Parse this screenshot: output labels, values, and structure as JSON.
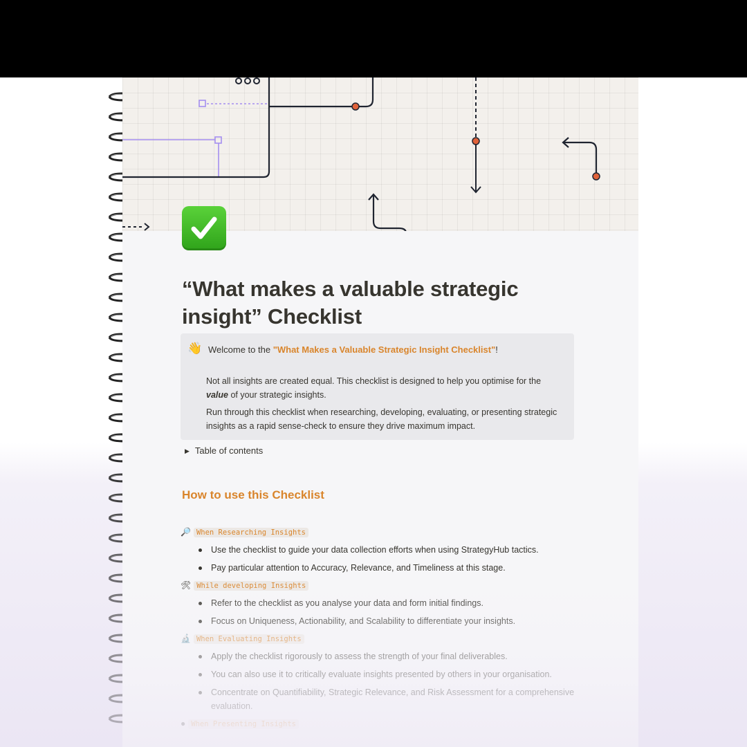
{
  "page": {
    "title": "“What makes a valuable strategic insight” Checklist",
    "icon": "check-mark-button-icon"
  },
  "callout": {
    "emoji": "👋",
    "lead_prefix": "Welcome to the ",
    "lead_highlight": "\"What Makes a Valuable Strategic Insight Checklist\"",
    "lead_suffix": "!",
    "p1_before": "Not all insights are created equal. This checklist is designed to help you optimise for the",
    "p1_emph": "value",
    "p1_after": " of your strategic insights.",
    "p2": "Run through this checklist when researching, developing, evaluating, or presenting strategic insights as a rapid sense-check to ensure they drive maximum impact."
  },
  "toc": {
    "label": "Table of contents"
  },
  "how_to": {
    "heading": "How to use this Checklist",
    "sections": [
      {
        "icon": "🔎",
        "label": "When Researching Insights",
        "bullets": [
          "Use the checklist to guide your data collection efforts when using StrategyHub tactics.",
          "Pay particular attention to Accuracy, Relevance, and Timeliness at this stage."
        ]
      },
      {
        "icon": "🛠",
        "label": "While developing Insights",
        "bullets": [
          "Refer to the checklist as you analyse your data and form initial findings.",
          "Focus on Uniqueness, Actionability, and Scalability to differentiate your insights."
        ]
      },
      {
        "icon": "🔬",
        "label": "When Evaluating Insights",
        "bullets": [
          "Apply the checklist rigorously to assess the strength of your final deliverables.",
          "You can also use it to critically evaluate insights presented by others in your organisation.",
          "Concentrate on Quantifiability, Strategic Relevance, and Risk Assessment for a comprehensive evaluation."
        ]
      },
      {
        "icon": "●",
        "label": "When Presenting Insights"
      }
    ]
  },
  "colors": {
    "accent": "#d9852c",
    "text": "#37352f",
    "callout_bg": "#e9e9ec",
    "cover_line": "#1f2430",
    "cover_dot": "#e0623a",
    "cover_purple": "#a48ef0"
  }
}
